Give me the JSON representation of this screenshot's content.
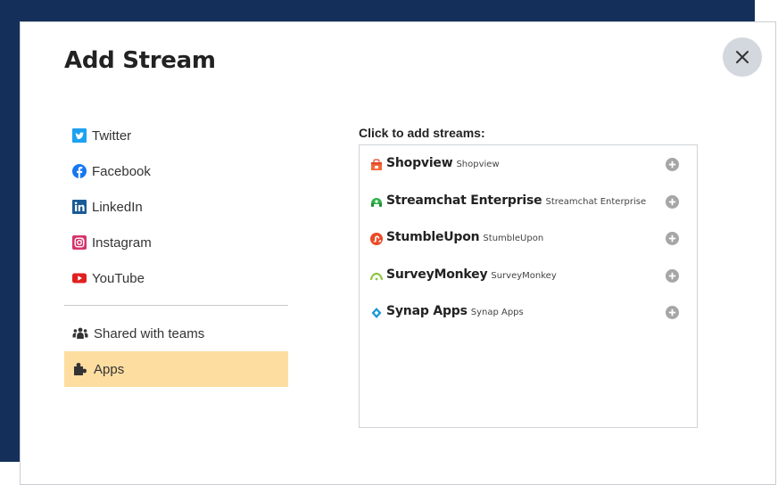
{
  "dialog": {
    "title": "Add Stream"
  },
  "networks": [
    {
      "label": "Twitter",
      "icon": "twitter-icon",
      "color": "#1da1f2"
    },
    {
      "label": "Facebook",
      "icon": "facebook-icon",
      "color": "#1877f2"
    },
    {
      "label": "LinkedIn",
      "icon": "linkedin-icon",
      "color": "#0a66c2"
    },
    {
      "label": "Instagram",
      "icon": "instagram-icon",
      "color": "#d6336c"
    },
    {
      "label": "YouTube",
      "icon": "youtube-icon",
      "color": "#e02020"
    }
  ],
  "groups": [
    {
      "label": "Shared with teams",
      "icon": "teams-icon",
      "active": false
    },
    {
      "label": "Apps",
      "icon": "puzzle-icon",
      "active": true
    }
  ],
  "streams": {
    "title": "Click to add streams:",
    "items": [
      {
        "name": "Shopview",
        "sub": "Shopview",
        "icon": "shopview-icon"
      },
      {
        "name": "Streamchat Enterprise",
        "sub": "Streamchat Enterprise",
        "icon": "streamchat-icon"
      },
      {
        "name": "StumbleUpon",
        "sub": "StumbleUpon",
        "icon": "stumbleupon-icon"
      },
      {
        "name": "SurveyMonkey",
        "sub": "SurveyMonkey",
        "icon": "surveymonkey-icon"
      },
      {
        "name": "Synap Apps",
        "sub": "Synap Apps",
        "icon": "synap-icon"
      }
    ]
  },
  "colors": {
    "backdrop": "#14305a",
    "active_bg": "#fddda0",
    "close_bg": "#d3d8de"
  }
}
